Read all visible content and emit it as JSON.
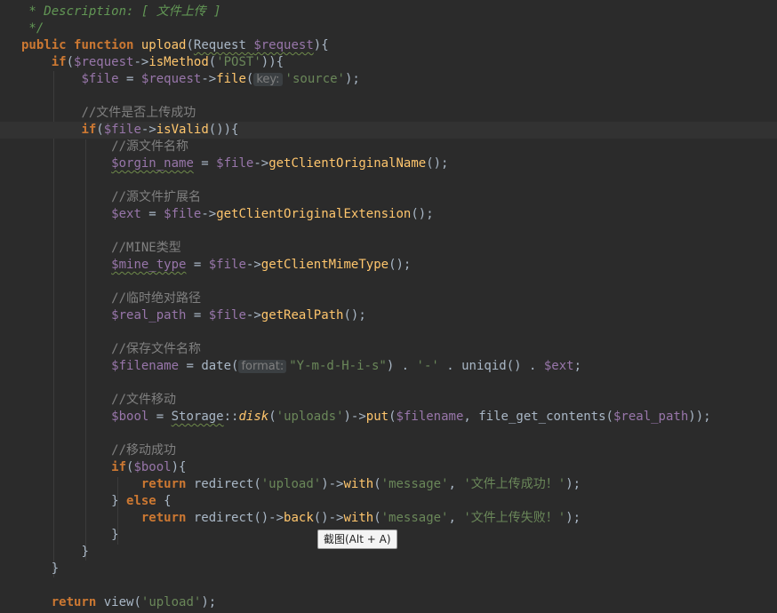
{
  "editor": {
    "current_line_index": 7,
    "lines": [
      [
        {
          "t": " * ",
          "c": "doc"
        },
        {
          "t": "Description: [ 文件上传 ]",
          "c": "doc"
        }
      ],
      [
        {
          "t": " */",
          "c": "doc"
        }
      ],
      [
        {
          "t": "public ",
          "c": "kw"
        },
        {
          "t": "function ",
          "c": "kw"
        },
        {
          "t": "upload",
          "c": "fn"
        },
        {
          "t": "(",
          "c": "plain"
        },
        {
          "t": "Request ",
          "c": "cls wavy"
        },
        {
          "t": "$request",
          "c": "var wavy"
        },
        {
          "t": "){",
          "c": "plain"
        }
      ],
      [
        {
          "t": "    "
        },
        {
          "t": "if",
          "c": "kw"
        },
        {
          "t": "(",
          "c": "plain"
        },
        {
          "t": "$request",
          "c": "var"
        },
        {
          "t": "->",
          "c": "plain"
        },
        {
          "t": "isMethod",
          "c": "fn"
        },
        {
          "t": "(",
          "c": "plain"
        },
        {
          "t": "'POST'",
          "c": "str"
        },
        {
          "t": ")){",
          "c": "plain"
        }
      ],
      [
        {
          "t": "        "
        },
        {
          "t": "$file",
          "c": "var"
        },
        {
          "t": " = ",
          "c": "plain"
        },
        {
          "t": "$request",
          "c": "var"
        },
        {
          "t": "->",
          "c": "plain"
        },
        {
          "t": "file",
          "c": "fn"
        },
        {
          "t": "(",
          "c": "plain"
        },
        {
          "t": "key:",
          "c": "hint"
        },
        {
          "t": "'source'",
          "c": "str"
        },
        {
          "t": ");",
          "c": "plain"
        }
      ],
      [],
      [
        {
          "t": "        "
        },
        {
          "t": "//文件是否上传成功",
          "c": "cmt"
        }
      ],
      [
        {
          "t": "        "
        },
        {
          "t": "if",
          "c": "kw"
        },
        {
          "t": "(",
          "c": "plain"
        },
        {
          "t": "$file",
          "c": "var"
        },
        {
          "t": "->",
          "c": "plain"
        },
        {
          "t": "isValid",
          "c": "fn"
        },
        {
          "t": "()){",
          "c": "plain"
        }
      ],
      [
        {
          "t": "            "
        },
        {
          "t": "//源文件名称",
          "c": "cmt"
        }
      ],
      [
        {
          "t": "            "
        },
        {
          "t": "$orgin_name",
          "c": "var wavy"
        },
        {
          "t": " = ",
          "c": "plain"
        },
        {
          "t": "$file",
          "c": "var"
        },
        {
          "t": "->",
          "c": "plain"
        },
        {
          "t": "getClientOriginalName",
          "c": "fn"
        },
        {
          "t": "();",
          "c": "plain"
        }
      ],
      [],
      [
        {
          "t": "            "
        },
        {
          "t": "//源文件扩展名",
          "c": "cmt"
        }
      ],
      [
        {
          "t": "            "
        },
        {
          "t": "$ext",
          "c": "var"
        },
        {
          "t": " = ",
          "c": "plain"
        },
        {
          "t": "$file",
          "c": "var"
        },
        {
          "t": "->",
          "c": "plain"
        },
        {
          "t": "getClientOriginalExtension",
          "c": "fn"
        },
        {
          "t": "();",
          "c": "plain"
        }
      ],
      [],
      [
        {
          "t": "            "
        },
        {
          "t": "//MINE类型",
          "c": "cmt"
        }
      ],
      [
        {
          "t": "            "
        },
        {
          "t": "$mine_type",
          "c": "var wavy"
        },
        {
          "t": " = ",
          "c": "plain"
        },
        {
          "t": "$file",
          "c": "var"
        },
        {
          "t": "->",
          "c": "plain"
        },
        {
          "t": "getClientMimeType",
          "c": "fn"
        },
        {
          "t": "();",
          "c": "plain"
        }
      ],
      [],
      [
        {
          "t": "            "
        },
        {
          "t": "//临时绝对路径",
          "c": "cmt"
        }
      ],
      [
        {
          "t": "            "
        },
        {
          "t": "$real_path",
          "c": "var"
        },
        {
          "t": " = ",
          "c": "plain"
        },
        {
          "t": "$file",
          "c": "var"
        },
        {
          "t": "->",
          "c": "plain"
        },
        {
          "t": "getRealPath",
          "c": "fn"
        },
        {
          "t": "();",
          "c": "plain"
        }
      ],
      [],
      [
        {
          "t": "            "
        },
        {
          "t": "//保存文件名称",
          "c": "cmt"
        }
      ],
      [
        {
          "t": "            "
        },
        {
          "t": "$filename",
          "c": "var"
        },
        {
          "t": " = ",
          "c": "plain"
        },
        {
          "t": "date",
          "c": "plain"
        },
        {
          "t": "(",
          "c": "plain"
        },
        {
          "t": "format:",
          "c": "hint"
        },
        {
          "t": "\"Y-m-d-H-i-s\"",
          "c": "str"
        },
        {
          "t": ") . ",
          "c": "plain"
        },
        {
          "t": "'-'",
          "c": "str"
        },
        {
          "t": " . ",
          "c": "plain"
        },
        {
          "t": "uniqid",
          "c": "plain"
        },
        {
          "t": "() . ",
          "c": "plain"
        },
        {
          "t": "$ext",
          "c": "var"
        },
        {
          "t": ";",
          "c": "plain"
        }
      ],
      [],
      [
        {
          "t": "            "
        },
        {
          "t": "//文件移动",
          "c": "cmt"
        }
      ],
      [
        {
          "t": "            "
        },
        {
          "t": "$bool",
          "c": "var"
        },
        {
          "t": " = ",
          "c": "plain"
        },
        {
          "t": "Storage",
          "c": "cls wavy"
        },
        {
          "t": "::",
          "c": "plain"
        },
        {
          "t": "disk",
          "c": "it"
        },
        {
          "t": "(",
          "c": "plain"
        },
        {
          "t": "'uploads'",
          "c": "str"
        },
        {
          "t": ")->",
          "c": "plain"
        },
        {
          "t": "put",
          "c": "fn"
        },
        {
          "t": "(",
          "c": "plain"
        },
        {
          "t": "$filename",
          "c": "var"
        },
        {
          "t": ", ",
          "c": "plain"
        },
        {
          "t": "file_get_contents",
          "c": "plain"
        },
        {
          "t": "(",
          "c": "plain"
        },
        {
          "t": "$real_path",
          "c": "var"
        },
        {
          "t": "));",
          "c": "plain"
        }
      ],
      [],
      [
        {
          "t": "            "
        },
        {
          "t": "//移动成功",
          "c": "cmt"
        }
      ],
      [
        {
          "t": "            "
        },
        {
          "t": "if",
          "c": "kw"
        },
        {
          "t": "(",
          "c": "plain"
        },
        {
          "t": "$bool",
          "c": "var"
        },
        {
          "t": "){",
          "c": "plain"
        }
      ],
      [
        {
          "t": "                "
        },
        {
          "t": "return ",
          "c": "kw"
        },
        {
          "t": "redirect",
          "c": "plain"
        },
        {
          "t": "(",
          "c": "plain"
        },
        {
          "t": "'upload'",
          "c": "str"
        },
        {
          "t": ")->",
          "c": "plain"
        },
        {
          "t": "with",
          "c": "fn"
        },
        {
          "t": "(",
          "c": "plain"
        },
        {
          "t": "'message'",
          "c": "str"
        },
        {
          "t": ", ",
          "c": "plain"
        },
        {
          "t": "'文件上传成功！'",
          "c": "str"
        },
        {
          "t": ");",
          "c": "plain"
        }
      ],
      [
        {
          "t": "            "
        },
        {
          "t": "} ",
          "c": "plain"
        },
        {
          "t": "else ",
          "c": "kw"
        },
        {
          "t": "{",
          "c": "plain"
        }
      ],
      [
        {
          "t": "                "
        },
        {
          "t": "return ",
          "c": "kw"
        },
        {
          "t": "redirect",
          "c": "plain"
        },
        {
          "t": "()->",
          "c": "plain"
        },
        {
          "t": "back",
          "c": "fn"
        },
        {
          "t": "()->",
          "c": "plain"
        },
        {
          "t": "with",
          "c": "fn"
        },
        {
          "t": "(",
          "c": "plain"
        },
        {
          "t": "'message'",
          "c": "str"
        },
        {
          "t": ", ",
          "c": "plain"
        },
        {
          "t": "'文件上传失败！'",
          "c": "str"
        },
        {
          "t": ");",
          "c": "plain"
        }
      ],
      [
        {
          "t": "            "
        },
        {
          "t": "}",
          "c": "plain"
        }
      ],
      [
        {
          "t": "        "
        },
        {
          "t": "}",
          "c": "plain"
        }
      ],
      [
        {
          "t": "    "
        },
        {
          "t": "}",
          "c": "plain"
        }
      ],
      [],
      [
        {
          "t": "    "
        },
        {
          "t": "return ",
          "c": "kw"
        },
        {
          "t": "view",
          "c": "plain"
        },
        {
          "t": "(",
          "c": "plain"
        },
        {
          "t": "'upload'",
          "c": "str"
        },
        {
          "t": ");",
          "c": "plain"
        }
      ]
    ]
  },
  "tooltip": {
    "text": "截图(Alt + A)"
  },
  "colors": {
    "background": "#2b2b2b",
    "keyword": "#cc7832",
    "variable": "#9876aa",
    "method": "#ffc66d",
    "string": "#6a8759",
    "comment": "#808080",
    "doc_comment": "#629755"
  }
}
